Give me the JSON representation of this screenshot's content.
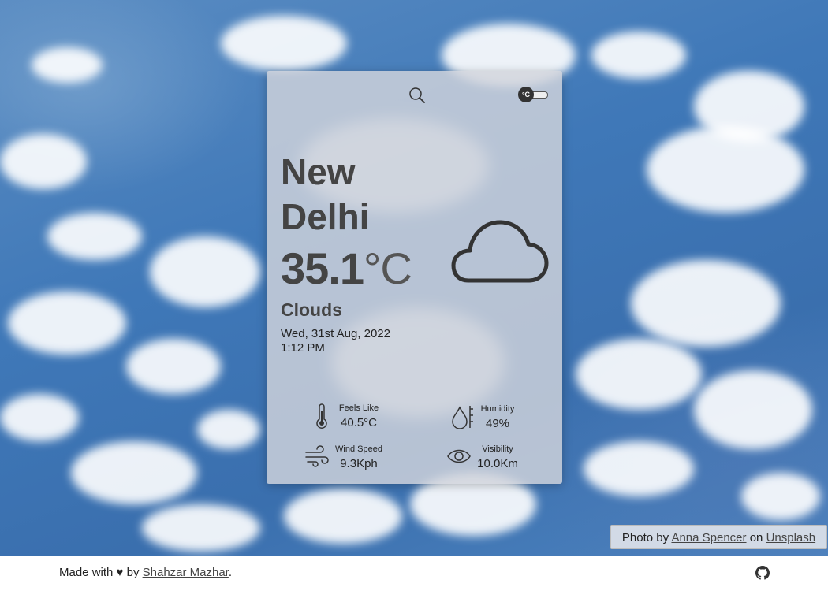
{
  "search": {
    "icon": "search-icon"
  },
  "unit_toggle": {
    "label": "°C"
  },
  "location": {
    "city": "New Delhi"
  },
  "weather": {
    "temperature": "35.1",
    "unit": "°C",
    "condition": "Clouds",
    "date": "Wed, 31st Aug, 2022",
    "time": "1:12 PM",
    "icon": "cloud-icon"
  },
  "stats": {
    "feels_like": {
      "label": "Feels Like",
      "value": "40.5°C",
      "icon": "thermometer-icon"
    },
    "humidity": {
      "label": "Humidity",
      "value": "49%",
      "icon": "humidity-icon"
    },
    "wind_speed": {
      "label": "Wind Speed",
      "value": "9.3Kph",
      "icon": "wind-icon"
    },
    "visibility": {
      "label": "Visibility",
      "value": "10.0Km",
      "icon": "eye-icon"
    }
  },
  "credit": {
    "prefix": "Photo by",
    "author": "Anna Spencer",
    "on": "on",
    "site": "Unsplash"
  },
  "footer": {
    "made_with": "Made with ♥ by",
    "author": "Shahzar Mazhar",
    "suffix": ".",
    "github_icon": "github-icon"
  }
}
